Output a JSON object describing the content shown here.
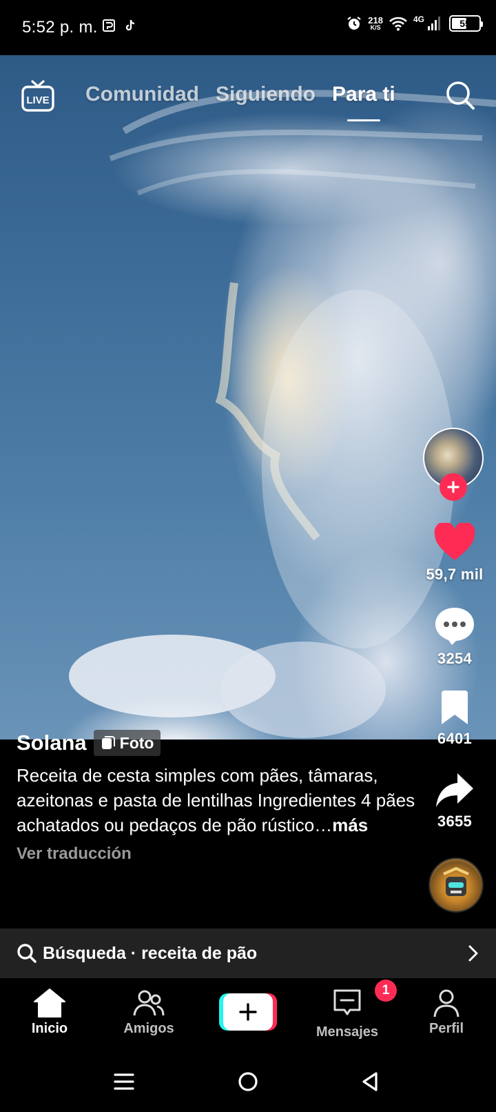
{
  "status_bar": {
    "time": "5:52 p. m.",
    "net_speed_value": "218",
    "net_speed_unit": "K/S",
    "network_type": "4G",
    "battery_level": "55",
    "battery_fraction": 0.55
  },
  "top_nav": {
    "live_label": "LIVE",
    "tabs": [
      {
        "label": "Comunidad",
        "active": false
      },
      {
        "label": "Siguiendo",
        "active": false
      },
      {
        "label": "Para ti",
        "active": true
      }
    ]
  },
  "post": {
    "username": "Solana",
    "tag_label": "Foto",
    "description": "Receita de cesta simples com pães, tâmaras, azeitonas e pasta de lentilhas Ingredientes 4 pães achatados ou pedaços de pão rústico…",
    "more_label": "más",
    "translate_label": "Ver traducción"
  },
  "actions": {
    "likes": "59,7 mil",
    "comments": "3254",
    "saves": "6401",
    "shares": "3655"
  },
  "search_bar": {
    "prefix": "Búsqueda",
    "separator": " · ",
    "query": "receita de pão"
  },
  "bottom_nav": {
    "items": [
      {
        "label": "Inicio",
        "active": true
      },
      {
        "label": "Amigos",
        "active": false
      },
      {
        "label": "Mensajes",
        "active": false
      },
      {
        "label": "Perfil",
        "active": false
      }
    ],
    "messages_badge": "1"
  },
  "colors": {
    "accent_red": "#fe2c55",
    "accent_cyan": "#25f4ee",
    "like_heart": "#fe2c55"
  }
}
